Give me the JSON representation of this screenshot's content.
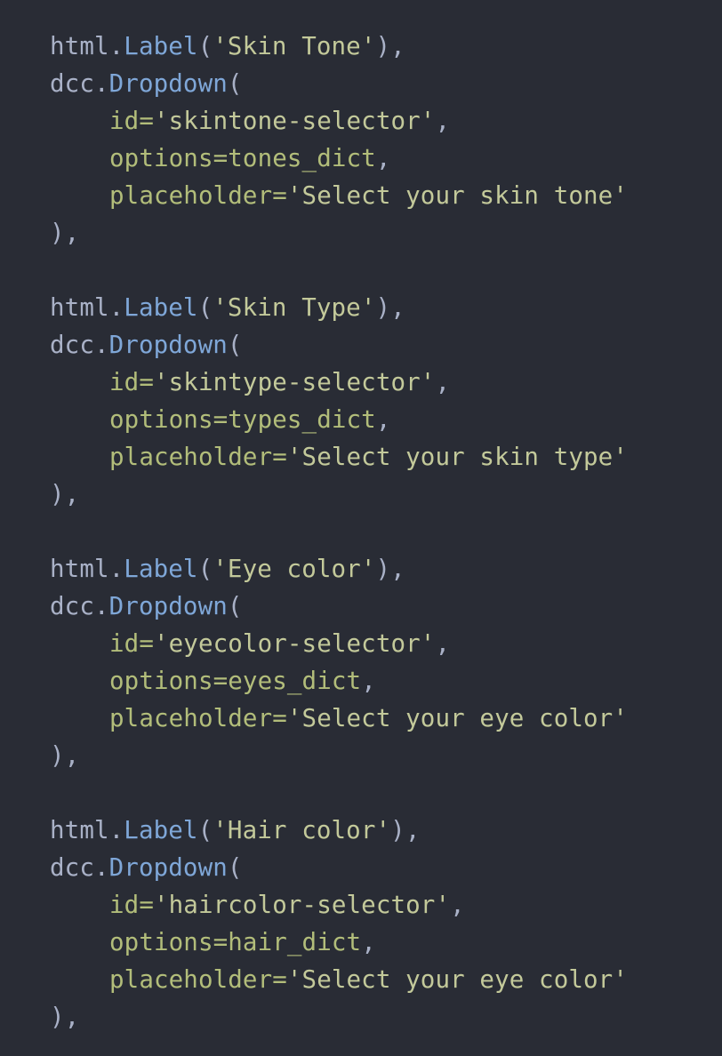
{
  "colors": {
    "background": "#292c35",
    "plain": "#a9b1c7",
    "function": "#7fa7d8",
    "keyword_arg": "#b2bd7a",
    "string": "#c3c99a"
  },
  "blocks": [
    {
      "label_obj": "html.",
      "label_fn": "Label",
      "label_open": "(",
      "label_str": "'Skin Tone'",
      "label_close": "),",
      "dd_obj": "dcc.",
      "dd_fn": "Dropdown",
      "dd_open": "(",
      "id_key": "id=",
      "id_val": "'skintone-selector'",
      "id_end": ",",
      "opt_key": "options=",
      "opt_val": "tones_dict",
      "opt_end": ",",
      "ph_key": "placeholder=",
      "ph_val": "'Select your skin tone'",
      "close": "),"
    },
    {
      "label_obj": "html.",
      "label_fn": "Label",
      "label_open": "(",
      "label_str": "'Skin Type'",
      "label_close": "),",
      "dd_obj": "dcc.",
      "dd_fn": "Dropdown",
      "dd_open": "(",
      "id_key": "id=",
      "id_val": "'skintype-selector'",
      "id_end": ",",
      "opt_key": "options=",
      "opt_val": "types_dict",
      "opt_end": ",",
      "ph_key": "placeholder=",
      "ph_val": "'Select your skin type'",
      "close": "),"
    },
    {
      "label_obj": "html.",
      "label_fn": "Label",
      "label_open": "(",
      "label_str": "'Eye color'",
      "label_close": "),",
      "dd_obj": "dcc.",
      "dd_fn": "Dropdown",
      "dd_open": "(",
      "id_key": "id=",
      "id_val": "'eyecolor-selector'",
      "id_end": ",",
      "opt_key": "options=",
      "opt_val": "eyes_dict",
      "opt_end": ",",
      "ph_key": "placeholder=",
      "ph_val": "'Select your eye color'",
      "close": "),"
    },
    {
      "label_obj": "html.",
      "label_fn": "Label",
      "label_open": "(",
      "label_str": "'Hair color'",
      "label_close": "),",
      "dd_obj": "dcc.",
      "dd_fn": "Dropdown",
      "dd_open": "(",
      "id_key": "id=",
      "id_val": "'haircolor-selector'",
      "id_end": ",",
      "opt_key": "options=",
      "opt_val": "hair_dict",
      "opt_end": ",",
      "ph_key": "placeholder=",
      "ph_val": "'Select your eye color'",
      "close": "),"
    }
  ]
}
